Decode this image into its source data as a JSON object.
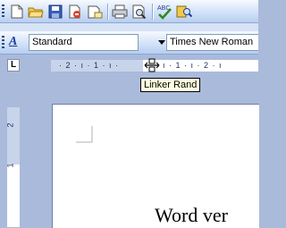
{
  "toolbar_standard": {
    "buttons": [
      {
        "icon": "new-document-icon"
      },
      {
        "icon": "open-folder-icon"
      },
      {
        "icon": "save-disk-icon"
      },
      {
        "icon": "permission-icon"
      },
      {
        "icon": "email-icon"
      },
      {
        "icon": "print-icon"
      },
      {
        "icon": "print-preview-icon"
      },
      {
        "icon": "spelling-grammar-icon"
      },
      {
        "icon": "research-icon"
      }
    ]
  },
  "toolbar_formatting": {
    "style_icon_label": "A",
    "style_value": "Standard",
    "font_value": "Times New Roman"
  },
  "ruler": {
    "tab_selector": "L",
    "left_text": "· 2 · ı · 1 · ı ·",
    "right_text": "ı · 1 · ı · 2 · ı",
    "vertical_labels": [
      "2",
      "1"
    ]
  },
  "tooltip": {
    "text": "Linker Rand"
  },
  "document": {
    "visible_text": "Word ver"
  },
  "colors": {
    "toolbar_gradient_top": "#f6f9ff",
    "toolbar_gradient_bottom": "#b8cdef",
    "workspace": "#aabadb",
    "tooltip_bg": "#ffffe1",
    "accent_blue": "#1f3f96"
  }
}
